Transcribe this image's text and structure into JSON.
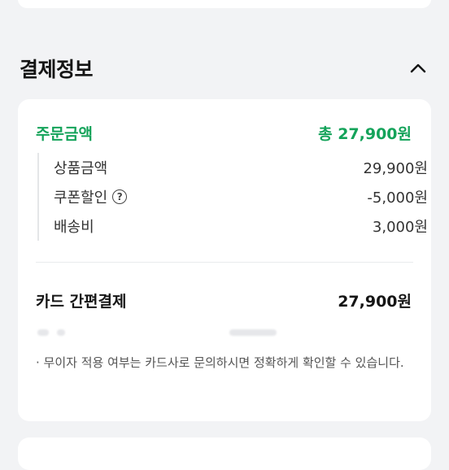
{
  "section": {
    "title": "결제정보",
    "collapse_icon": "chevron-up-icon"
  },
  "order": {
    "label": "주문금액",
    "total": "총 27,900원",
    "accent_color": "#14a35a"
  },
  "items": [
    {
      "label": "상품금액",
      "value": "29,900원"
    },
    {
      "label": "쿠폰할인",
      "value": "-5,000원",
      "help_icon": "question-circle-icon"
    },
    {
      "label": "배송비",
      "value": "3,000원"
    }
  ],
  "payment": {
    "method": "카드 간편결제",
    "amount": "27,900원"
  },
  "notice": "· 무이자 적용 여부는 카드사로 문의하시면 정확하게 확인할 수 있습니다."
}
